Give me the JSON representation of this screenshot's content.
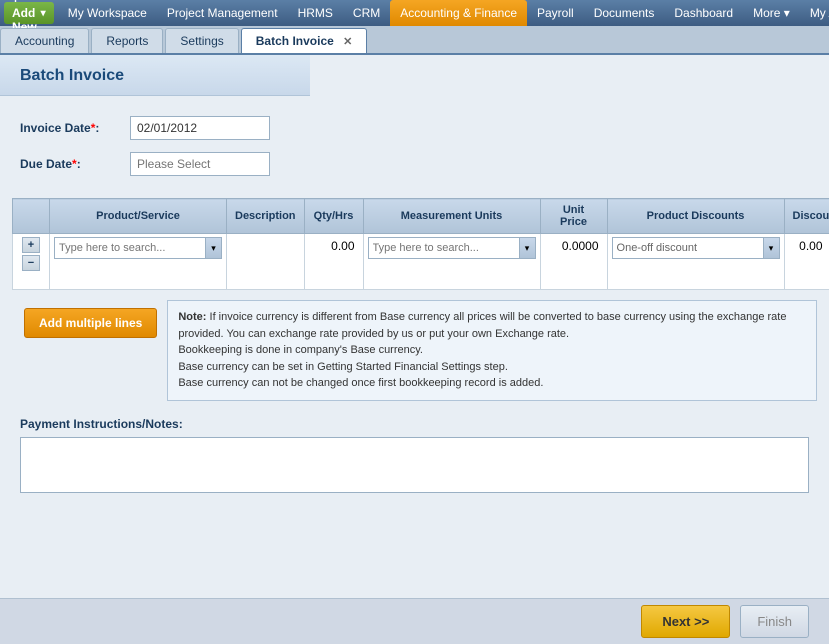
{
  "topnav": {
    "add_new": "+ Add New",
    "add_arrow": "▾",
    "items": [
      {
        "label": "My Workspace",
        "active": false
      },
      {
        "label": "Project Management",
        "active": false
      },
      {
        "label": "HRMS",
        "active": false
      },
      {
        "label": "CRM",
        "active": false
      },
      {
        "label": "Accounting & Finance",
        "active": true
      },
      {
        "label": "Payroll",
        "active": false
      },
      {
        "label": "Documents",
        "active": false
      },
      {
        "label": "Dashboard",
        "active": false
      },
      {
        "label": "More ▾",
        "active": false
      },
      {
        "label": "My Acc...",
        "active": false
      }
    ]
  },
  "tabs": [
    {
      "label": "Accounting",
      "active": false,
      "closeable": false
    },
    {
      "label": "Reports",
      "active": false,
      "closeable": false
    },
    {
      "label": "Settings",
      "active": false,
      "closeable": false
    },
    {
      "label": "Batch Invoice",
      "active": true,
      "closeable": true
    }
  ],
  "page": {
    "title": "Batch Invoice"
  },
  "form": {
    "invoice_date_label": "Invoice Date",
    "invoice_date_value": "02/01/2012",
    "due_date_label": "Due Date",
    "due_date_placeholder": "Please Select"
  },
  "table": {
    "headers": [
      "",
      "Product/Service",
      "Description",
      "Qty/Hrs",
      "Measurement Units",
      "Unit Price",
      "Product Discounts",
      "Discou..."
    ],
    "row": {
      "qty": "0.00",
      "unit_price": "0.0000",
      "discount_type": "One-off discount",
      "discount_val": "0.00",
      "product_placeholder": "Type here to search...",
      "meas_placeholder": "Type here to search..."
    }
  },
  "add_lines_btn": "Add multiple lines",
  "note": {
    "label": "Note:",
    "text": "If invoice currency is different from Base currency all prices will be converted to base currency using the exchange rate provided. You can exchange rate provided by us or put your own Exchange rate.\nBookkeeping is done in company's Base currency.\nBase currency can be set in Getting Started Financial Settings step.\nBase currency can not be changed once first bookkeeping record is added."
  },
  "payment": {
    "label": "Payment Instructions/Notes:"
  },
  "buttons": {
    "next": "Next >>",
    "finish": "Finish"
  }
}
